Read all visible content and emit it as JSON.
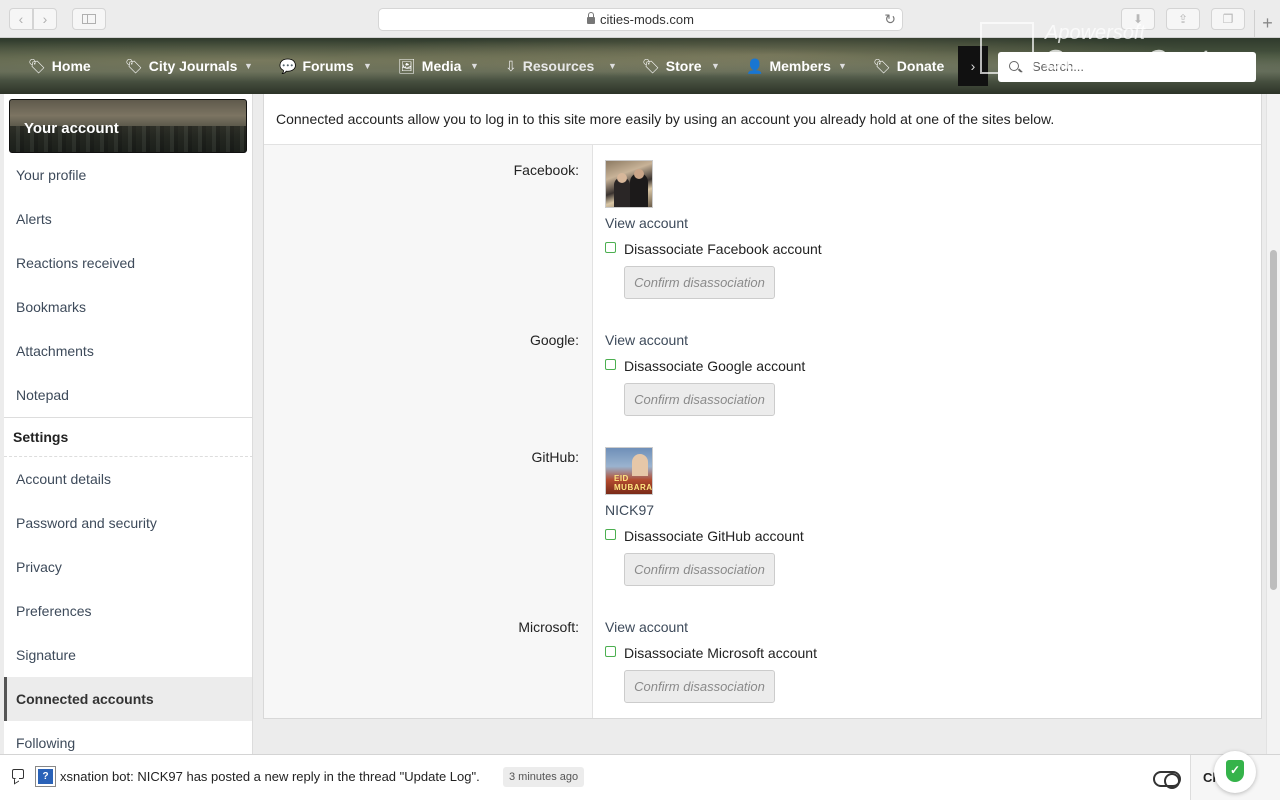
{
  "browser": {
    "url": "cities-mods.com",
    "back_glyph": "‹",
    "forward_glyph": "›",
    "reload_glyph": "↻",
    "new_tab_glyph": "+"
  },
  "nav": {
    "items": [
      {
        "label": "Home",
        "icon": "tag-icon"
      },
      {
        "label": "City Journals",
        "icon": "tag-icon"
      },
      {
        "label": "Forums",
        "icon": "comments-icon"
      },
      {
        "label": "Media",
        "icon": "image-icon"
      },
      {
        "label": "Resources",
        "icon": "download-icon"
      },
      {
        "label": "Store",
        "icon": "tag-icon"
      },
      {
        "label": "Members",
        "icon": "user-icon"
      },
      {
        "label": "Donate",
        "icon": "tag-icon"
      }
    ],
    "more_glyph": "›",
    "search_placeholder": "Search..."
  },
  "watermark": {
    "line1": "Apowersoft",
    "line2": "Screen Capture"
  },
  "sidebar": {
    "account_header": "Your account",
    "account_items": [
      "Your profile",
      "Alerts",
      "Reactions received",
      "Bookmarks",
      "Attachments",
      "Notepad"
    ],
    "settings_header": "Settings",
    "settings_items": [
      "Account details",
      "Password and security",
      "Privacy",
      "Preferences",
      "Signature",
      "Connected accounts",
      "Following"
    ],
    "active_item": "Connected accounts"
  },
  "main": {
    "intro": "Connected accounts allow you to log in to this site more easily by using an account you already hold at one of the sites below.",
    "providers": [
      {
        "label": "Facebook:",
        "link": "View account",
        "disassociate": "Disassociate Facebook account",
        "confirm": "Confirm disassociation"
      },
      {
        "label": "Google:",
        "link": "View account",
        "disassociate": "Disassociate Google account",
        "confirm": "Confirm disassociation"
      },
      {
        "label": "GitHub:",
        "link": "NICK97",
        "avatar_text": "EID MUBARAK",
        "disassociate": "Disassociate GitHub account",
        "confirm": "Confirm disassociation"
      },
      {
        "label": "Microsoft:",
        "link": "View account",
        "disassociate": "Disassociate Microsoft account",
        "confirm": "Confirm disassociation"
      }
    ]
  },
  "notification": {
    "bot_icon_glyph": "?",
    "message": "xsnation bot: NICK97 has posted a new reply in the thread \"Update Log\".",
    "time": "3 minutes ago",
    "close_label": "Cl",
    "shield_glyph": "✓"
  },
  "colors": {
    "accent_check": "#4caf50",
    "link": "#3d4a5a",
    "shield": "#35b34a"
  }
}
